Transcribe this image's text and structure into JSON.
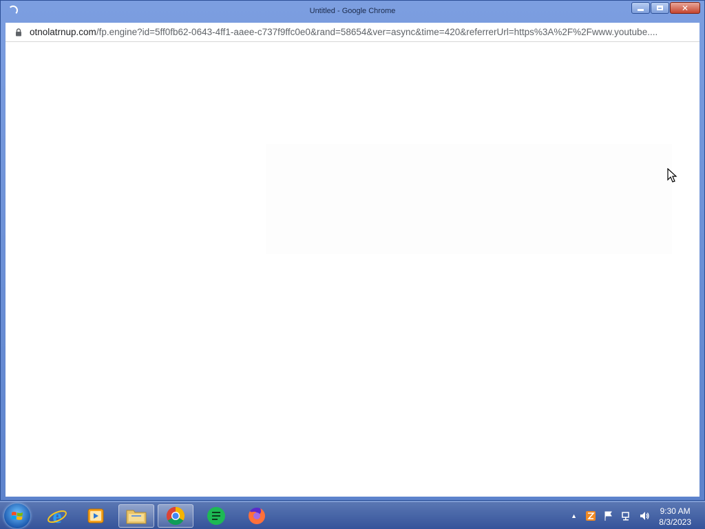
{
  "window": {
    "title": "Untitled - Google Chrome",
    "controls": {
      "minimize": "minimize-icon",
      "maximize": "maximize-icon",
      "close": "close-icon"
    }
  },
  "address": {
    "host": "otnolatrnup.com",
    "path": "/fp.engine?id=5ff0fb62-0643-4ff1-aaee-c737f9ffc0e0&rand=58654&ver=async&time=420&referrerUrl=https%3A%2F%2Fwww.youtube...."
  },
  "taskbar": {
    "items": [
      {
        "name": "internet-explorer",
        "icon": "internet-explorer-icon"
      },
      {
        "name": "media-player",
        "icon": "media-player-icon"
      },
      {
        "name": "file-explorer",
        "icon": "folder-icon"
      },
      {
        "name": "google-chrome",
        "icon": "chrome-icon",
        "active": true
      },
      {
        "name": "notes-app",
        "icon": "notes-icon"
      },
      {
        "name": "firefox",
        "icon": "firefox-icon"
      }
    ],
    "tray": {
      "show_hidden": "▲"
    },
    "clock": {
      "time": "9:30 AM",
      "date": "8/3/2023"
    }
  },
  "colors": {
    "taskbar": "#3b5aa0",
    "titlebar": "#6e91d8",
    "close": "#c6452e"
  }
}
